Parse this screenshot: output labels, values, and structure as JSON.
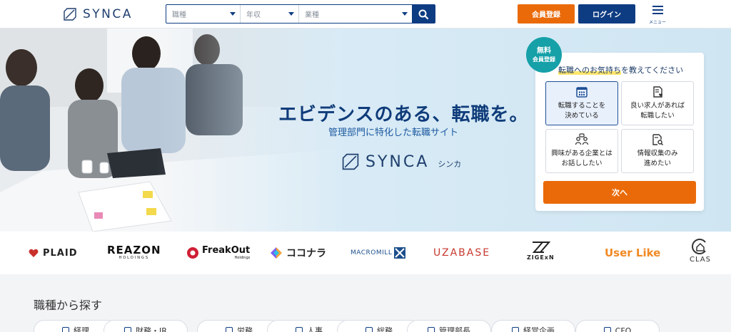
{
  "header": {
    "logo_text": "SYNCA",
    "search": {
      "job_type_placeholder": "職種",
      "income_placeholder": "年収",
      "industry_placeholder": "業種"
    },
    "register_label": "会員登録",
    "login_label": "ログイン",
    "menu_label": "メニュー"
  },
  "hero": {
    "title": "エビデンスのある、転職を。",
    "subtitle": "管理部門に特化した転職サイト",
    "logo_text": "SYNCA",
    "logo_kana": "シンカ"
  },
  "form": {
    "badge_line1": "無料",
    "badge_line2": "会員登録",
    "question_highlight": "転職へのお気持ち",
    "question_rest": "を教えてください",
    "options": [
      {
        "label": "転職することを\n決めている",
        "icon": "calendar-icon",
        "selected": true
      },
      {
        "label": "良い求人があれば\n転職したい",
        "icon": "document-heart-icon",
        "selected": false
      },
      {
        "label": "興味がある企業とは\nお話ししたい",
        "icon": "people-talk-icon",
        "selected": false
      },
      {
        "label": "情報収集のみ\n進めたい",
        "icon": "document-search-icon",
        "selected": false
      }
    ],
    "next_label": "次へ"
  },
  "company_logos": [
    {
      "name": "PLAID",
      "color": "#222222"
    },
    {
      "name": "REAZON",
      "sub": "HOLDINGS",
      "color": "#111111"
    },
    {
      "name": "FreakOut",
      "sub": "Holdings",
      "color": "#111111"
    },
    {
      "name": "ココナラ",
      "color": "#222222"
    },
    {
      "name": "MACROMILL",
      "color": "#1c4f8c"
    },
    {
      "name": "UZABASE",
      "color": "#c8382f"
    },
    {
      "name": "ZIGExN",
      "color": "#222222"
    },
    {
      "name": "User Like",
      "color": "#f08a24"
    },
    {
      "name": "CLAS",
      "color": "#333333"
    }
  ],
  "jobs": {
    "title": "職種から探す",
    "chips": [
      "経理",
      "財務・IR",
      "労務",
      "人事",
      "総務",
      "管理部長",
      "経営企画",
      "CFO"
    ]
  },
  "colors": {
    "navy": "#0e3c82",
    "orange": "#ea6a0a",
    "teal_badge": "#16a0a8"
  }
}
